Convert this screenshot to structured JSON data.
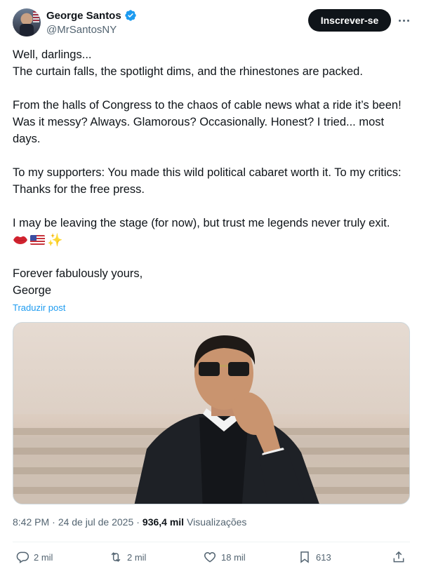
{
  "author": {
    "name": "George Santos",
    "handle": "@MrSantosNY",
    "verified_icon": "verified-badge-icon",
    "avatar_icon": "avatar"
  },
  "header": {
    "subscribe_label": "Inscrever-se",
    "more_icon": "more-options-icon"
  },
  "post": {
    "lines": {
      "l1": "Well, darlings...",
      "l2": "The curtain falls, the spotlight dims, and the rhinestones are packed.",
      "l3": "From the halls of Congress to the chaos of cable news what a ride it’s been! Was it messy? Always. Glamorous? Occasionally. Honest? I tried... most days.",
      "l4": "To my supporters: You made this wild political cabaret worth it. To my critics: Thanks for the free press.",
      "l5": "I may be leaving the stage (for now), but trust me legends never truly exit.",
      "l6": "Forever fabulously yours,",
      "l7": "George"
    },
    "emojis": [
      "lips-emoji",
      "us-flag-emoji",
      "sparkles-emoji"
    ],
    "translate_label": "Traduzir post"
  },
  "meta": {
    "time": "8:42 PM",
    "separator1": "·",
    "date": "24 de jul de 2025",
    "separator2": "·",
    "views_count": "936,4 mil",
    "views_label": "Visualizações"
  },
  "actions": {
    "replies": "2 mil",
    "reposts": "2 mil",
    "likes": "18 mil",
    "bookmarks": "613"
  },
  "colors": {
    "accent": "#1d9bf0",
    "text": "#0f1419",
    "muted": "#536471",
    "button_bg": "#0f1419"
  }
}
